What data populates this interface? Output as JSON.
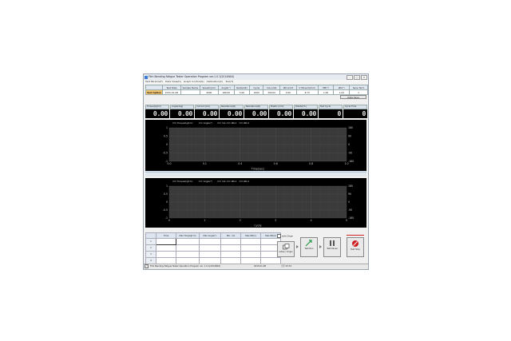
{
  "window": {
    "title": "Film Bending Fatigue Tester Operation Program  ver.1.0.1(2014N04)",
    "controls": [
      "–",
      "□",
      "✕"
    ]
  },
  "menu": [
    "Test Params(F)",
    "Data View(D)",
    "Graph Control(G)",
    "Calibration(C)",
    "Tool(T)"
  ],
  "config_table": {
    "headers": [
      "",
      "Test Date",
      "Sample Name",
      "Speed(rpm)",
      "Angle(°)",
      "Radius(R)",
      "Cycle",
      "mA Limit",
      "Ø0 Limit",
      "V Movem(mm)",
      "PM(*)",
      "Ø0(*)",
      "Save Term"
    ],
    "row_label": "Test Option",
    "row": [
      "2015-01-08",
      "",
      "4000",
      "180.00",
      "5.00",
      "1000",
      "300.00",
      "0.00",
      "8.75",
      "1.00",
      "1.00",
      "1"
    ]
  },
  "data_save_label": "Data Save",
  "meters": [
    {
      "label": "Torque(kgf·m)",
      "value": "0.00"
    },
    {
      "label": "Angle(deg)",
      "value": "0.00"
    },
    {
      "label": "Current (mA)",
      "value": "0.00"
    },
    {
      "label": "Resistance(Ω)",
      "value": "0.00"
    },
    {
      "label": "Resistance(Ω)",
      "value": "0.00"
    },
    {
      "label": "Elastic (mm)",
      "value": "0.00"
    },
    {
      "label": "R.Ratio(%)",
      "value": "0.00"
    },
    {
      "label": "Test Cycle",
      "value": "0"
    },
    {
      "label": "Cycle Time",
      "value": "0"
    }
  ],
  "chart_data": [
    {
      "type": "line",
      "xlabel": "Time(sec)",
      "x_ticks": [
        "0.0",
        "0.1",
        "0.4",
        "0.6",
        "0.8",
        "1.0"
      ],
      "y_left_ticks": [
        "1",
        "0.5",
        "0",
        "-0.5",
        "-1"
      ],
      "y_right_ticks": [
        "180",
        "90",
        "0",
        "-90",
        "-180"
      ],
      "legend": [
        "Torque(kgf·m)",
        "Angle(°)",
        "mA",
        "Ø0-1",
        "Ø0-2"
      ],
      "series": []
    },
    {
      "type": "line",
      "xlabel": "Cycle",
      "x_ticks": [
        "0",
        "1",
        "2",
        "3",
        "4",
        "5"
      ],
      "y_left_ticks": [
        "1",
        "0.5",
        "0",
        "-0.5",
        "-1"
      ],
      "y_right_ticks": [
        "180",
        "90",
        "0",
        "-90",
        "-180"
      ],
      "legend": [
        "Torque(kgf·m)",
        "Angle(°)",
        "mA",
        "Ø0-1",
        "Ø0-2"
      ],
      "series": []
    }
  ],
  "data_grid": {
    "headers": [
      "",
      "Time",
      "Max Torq(kgf·m)",
      "Max Angle(°)",
      "Min. mA",
      "Max Ø0(1)",
      "Max Ø0(2)"
    ],
    "rows": [
      "1",
      "2",
      "3",
      "4"
    ]
  },
  "controls": {
    "with_origin_label": "with Origin",
    "buttons": [
      {
        "label": "Initial / Origin",
        "icon": "origin-icon"
      },
      {
        "label": "Test Run",
        "icon": "run-icon"
      },
      {
        "label": "Test Pause",
        "icon": "pause-icon"
      },
      {
        "label": "Test Stop",
        "icon": "stop-icon"
      }
    ]
  },
  "status": {
    "app": "Film Bending Fatigue Tester Operation Program  ver. 1.0.1(2014N04)",
    "date": "2015-01-08",
    "time": "오후 03:34"
  },
  "colors": {
    "accent": "#f3c46b",
    "meter_bg": "#000000",
    "plot_bg": "#3a3a3a",
    "stop": "#cc2222"
  }
}
